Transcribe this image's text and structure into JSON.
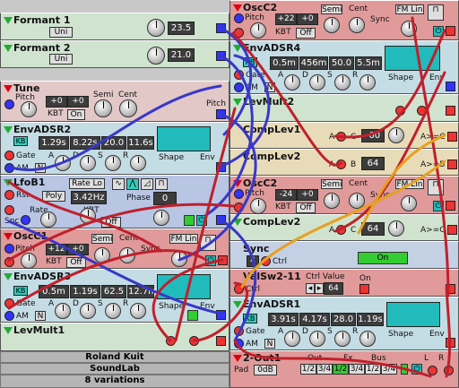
{
  "modules": {
    "formant1": {
      "title": "Formant 1",
      "mode": "Uni",
      "value": "23.5"
    },
    "formant2": {
      "title": "Formant 2",
      "mode": "Uni",
      "value": "21.0"
    },
    "tune": {
      "title": "Tune",
      "pitch_label": "Pitch",
      "value_a": "+0",
      "value_b": "+0",
      "kbt_label": "KBT",
      "kbt_value": "On",
      "semi": "Semi",
      "cent": "Cent",
      "pitch_right": "Pitch"
    },
    "envadsr2": {
      "title": "EnvADSR2",
      "kb": "KB",
      "a": "1.29s",
      "d": "8.22s",
      "s": "20.0",
      "r": "11.6s",
      "gate": "Gate",
      "am": "AM",
      "n": "N",
      "labels": [
        "A",
        "D",
        "S",
        "R"
      ],
      "shape": "Shape",
      "env": "Env"
    },
    "lfob1": {
      "title": "LfoB1",
      "rate": "Rate Lo",
      "rst": "Rst",
      "mode": "Poly",
      "freq": "3.42Hz",
      "phase_label": "Phase",
      "phase": "0",
      "snc": "Snc",
      "rate_label": "Rate",
      "kbt": "KBT",
      "kbt_value": "Off"
    },
    "osc_c1": {
      "title": "OscC1",
      "pitch": "Pitch",
      "semi": "Semi",
      "cent": "Cent",
      "v1": "+12",
      "v2": "+0",
      "kbt": "KBT",
      "kbt_value": "Off",
      "fm": "FM Lin",
      "sync": "Sync"
    },
    "envadsr3": {
      "title": "EnvADSR3",
      "kb": "KB",
      "a": "0.5m",
      "d": "1.19s",
      "s": "62.5",
      "r": "12.7m",
      "gate": "Gate",
      "am": "AM",
      "n": "N",
      "labels": [
        "A",
        "D",
        "S",
        "R"
      ],
      "shape": "Shape",
      "env": "Env"
    },
    "levmult1": {
      "title": "LevMult1"
    },
    "osc_c2_top": {
      "title": "OscC2",
      "pitch": "Pitch",
      "semi": "Semi",
      "cent": "Cent",
      "v1": "+22",
      "v2": "+0",
      "kbt": "KBT",
      "kbt_value": "Off",
      "fm": "FM Lin",
      "sync": "Sync"
    },
    "envadsr4": {
      "title": "EnvADSR4",
      "kb": "KB",
      "a": "0.5m",
      "d": "456m",
      "s": "50.0",
      "r": "5.5m",
      "gate": "Gate",
      "am": "AM",
      "n": "N",
      "labels": [
        "A",
        "D",
        "S",
        "R"
      ],
      "shape": "Shape",
      "env": "Env"
    },
    "levmult2": {
      "title": "LevMult2"
    },
    "complev1": {
      "title": "CompLev1",
      "a": "A",
      "c": "C",
      "value": "-60",
      "out": "A>=C"
    },
    "complev2a": {
      "title": "CompLev2",
      "a": "A",
      "b": "B",
      "out": "A>=B",
      "value": "64"
    },
    "osc_c2_mid": {
      "title": "OscC2",
      "pitch": "Pitch",
      "v1": "-24",
      "v2": "+0",
      "kbt": "KBT",
      "kbt_value": "Off",
      "semi": "Semi",
      "cent": "Cent",
      "fm": "FM Lin",
      "sync": "Sync"
    },
    "complev2b": {
      "title": "CompLev2",
      "a": "A",
      "c": "C",
      "value": "64",
      "out": "A>=C"
    },
    "sync": {
      "title": "Sync",
      "value": "4",
      "ctrl": "Ctrl",
      "on": "On"
    },
    "valsw": {
      "title": "ValSw2-11",
      "ctrl_value": "Ctrl Value",
      "value": "64",
      "on": "On",
      "ctrl": "Ctrl"
    },
    "envadsr1": {
      "title": "EnvADSR1",
      "kb": "KB",
      "a": "3.91s",
      "d": "4.17s",
      "s": "28.0",
      "r": "1.19s",
      "gate": "Gate",
      "am": "AM",
      "n": "N",
      "labels": [
        "A",
        "D",
        "S",
        "R"
      ],
      "shape": "Shape",
      "env": "Env"
    },
    "out": {
      "title": "2-Out1",
      "pad": "Pad",
      "pad_value": "0dB",
      "out": "Out",
      "fx": "Fx",
      "bus": "Bus",
      "l": "L",
      "r": "R",
      "out_btns": [
        "1/2",
        "3/4"
      ],
      "fx_btns": [
        "1/2",
        "3/4"
      ],
      "bus_btns": [
        "1/2",
        "3/4"
      ]
    }
  },
  "footer": {
    "author": "Roland Kuit",
    "title": "SoundLab",
    "variations": "8 variations"
  },
  "colors": {
    "green_mod": "#cfe3cf",
    "pink_mod": "#e3c8c8",
    "blue_mod": "#b8c6e4",
    "tan_mod": "#e8dcb8",
    "red_mod": "#e09a9a",
    "cyan_mod": "#c4dce4",
    "cable_red": "#c0202c",
    "cable_blue": "#3838c8",
    "cable_orange": "#e8a020"
  }
}
